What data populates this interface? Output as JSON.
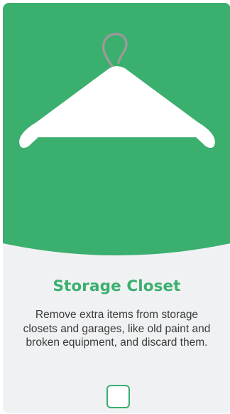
{
  "card": {
    "title": "Storage Closet",
    "description": "Remove extra items from storage closets and garages, like old paint and broken equipment, and discard them.",
    "icon": "clothes-hanger-icon",
    "checked": false
  },
  "colors": {
    "accent": "#3aaf6e",
    "card_background": "#f0f1f2",
    "icon": "#ffffff",
    "hook": "#9a9a9a"
  }
}
